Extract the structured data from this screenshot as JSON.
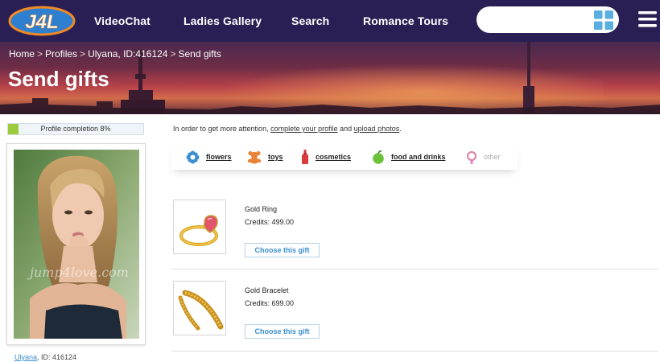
{
  "logo": {
    "text": "J4L"
  },
  "nav": {
    "items": [
      {
        "label": "VideoChat"
      },
      {
        "label": "Ladies Gallery"
      },
      {
        "label": "Search"
      },
      {
        "label": "Romance Tours"
      }
    ],
    "search_value": ""
  },
  "breadcrumb": {
    "items": [
      "Home",
      "Profiles",
      "Ulyana, ID:416124",
      "Send gifts"
    ],
    "separator": ">"
  },
  "page_title": "Send gifts",
  "sidebar": {
    "profile_completion": {
      "label": "Profile completion 8%",
      "value": 0.08
    },
    "watermark": "jump4love.com",
    "profile": {
      "name": "Ulyana",
      "id_text": ", ID: 416124"
    }
  },
  "notice": {
    "prefix": "In order to get more attention, ",
    "link1": "complete your profile",
    "middle": " and ",
    "link2": "upload photos",
    "suffix": "."
  },
  "categories": [
    {
      "label": "flowers",
      "icon": "flower-icon",
      "color": "#3a8fd0"
    },
    {
      "label": "toys",
      "icon": "teddy-bear-icon",
      "color": "#e8833a"
    },
    {
      "label": "cosmetics",
      "icon": "perfume-icon",
      "color": "#d93a3a"
    },
    {
      "label": "food and drinks",
      "icon": "apple-icon",
      "color": "#6cc23a"
    },
    {
      "label": "other",
      "icon": "ring-icon",
      "color": "#d98ab0",
      "disabled": true
    }
  ],
  "gifts": [
    {
      "name": "Gold Ring",
      "price": "Credits: 499.00",
      "button": "Choose this gift",
      "image": "gold-ring-image"
    },
    {
      "name": "Gold Bracelet",
      "price": "Credits: 699.00",
      "button": "Choose this gift",
      "image": "gold-bracelet-image"
    }
  ],
  "colors": {
    "nav_bg": "#2a1f54",
    "link_blue": "#3a8fd0",
    "progress_green": "#9ccc3c",
    "logo_orange": "#f08a24"
  }
}
